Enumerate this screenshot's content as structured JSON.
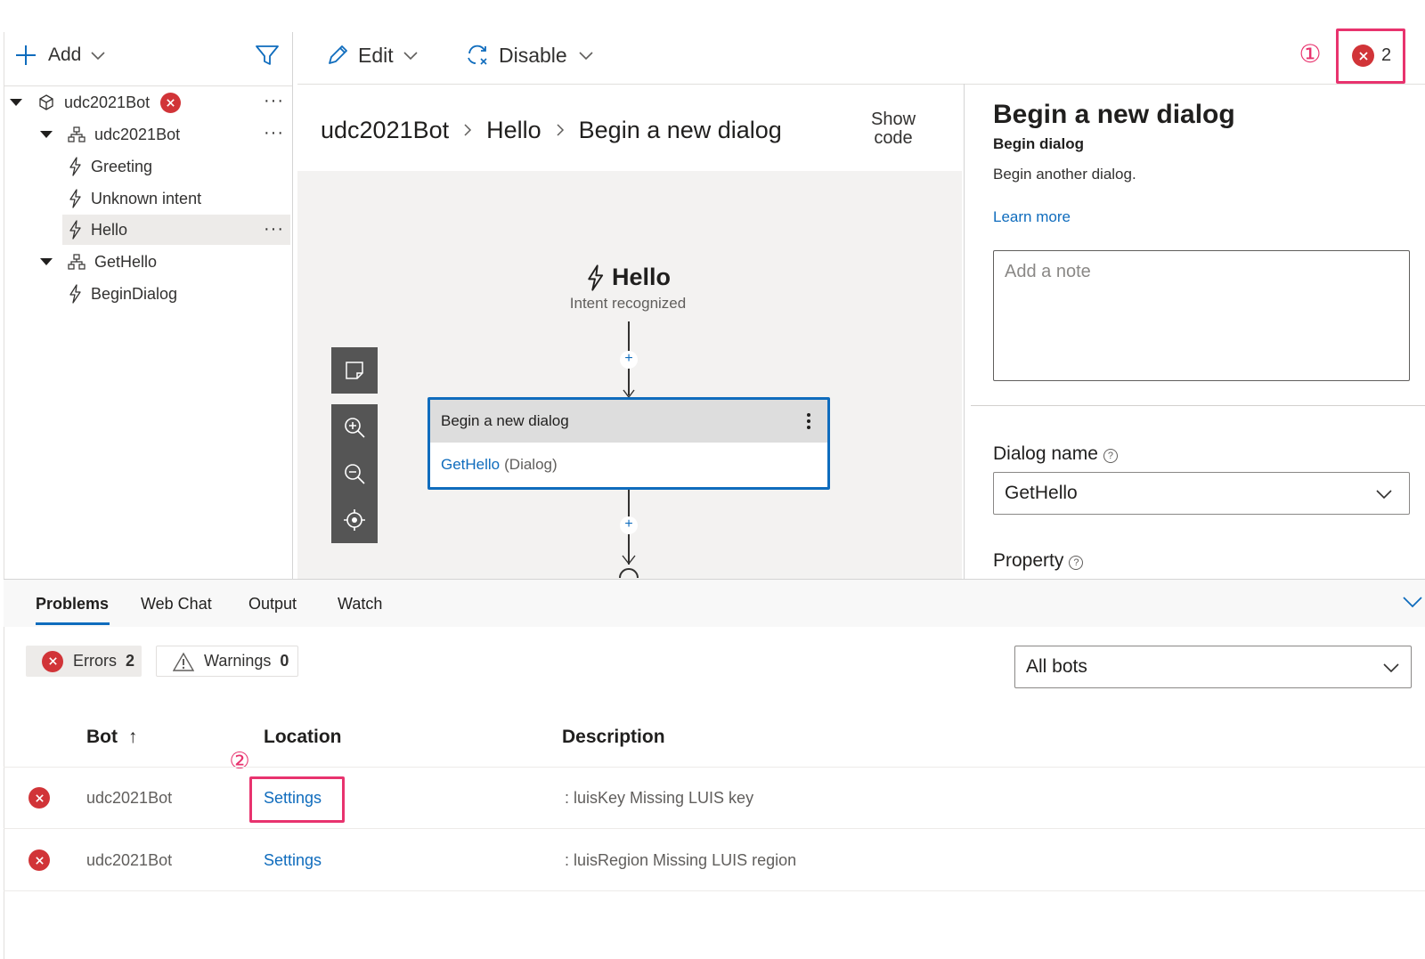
{
  "toolbar": {
    "add_label": "Add",
    "edit_label": "Edit",
    "disable_label": "Disable",
    "error_count": "2",
    "callout_1": "①"
  },
  "tree": {
    "items": [
      {
        "label": "udc2021Bot",
        "type": "bot",
        "has_error": true
      },
      {
        "label": "udc2021Bot",
        "type": "dialog"
      },
      {
        "label": "Greeting",
        "type": "trigger"
      },
      {
        "label": "Unknown intent",
        "type": "trigger"
      },
      {
        "label": "Hello",
        "type": "trigger",
        "selected": true
      },
      {
        "label": "GetHello",
        "type": "dialog"
      },
      {
        "label": "BeginDialog",
        "type": "trigger"
      }
    ]
  },
  "breadcrumb": {
    "items": [
      "udc2021Bot",
      "Hello",
      "Begin a new dialog"
    ],
    "separator": ">"
  },
  "show_code": {
    "line1": "Show",
    "line2": "code"
  },
  "canvas": {
    "trigger_title": "Hello",
    "trigger_subtitle": "Intent recognized",
    "node_title": "Begin a new dialog",
    "node_link": "GetHello",
    "node_suffix": "(Dialog)"
  },
  "properties": {
    "title": "Begin a new dialog",
    "subtitle": "Begin dialog",
    "description": "Begin another dialog.",
    "learn_more": "Learn more",
    "note_placeholder": "Add a note",
    "dialog_name_label": "Dialog name",
    "dialog_name_value": "GetHello",
    "property_label": "Property"
  },
  "bottom": {
    "tabs": [
      "Problems",
      "Web Chat",
      "Output",
      "Watch"
    ],
    "errors_label": "Errors",
    "errors_count": "2",
    "warnings_label": "Warnings",
    "warnings_count": "0",
    "filter_value": "All bots",
    "columns": [
      "Bot",
      "Location",
      "Description"
    ],
    "sort_indicator": "↑",
    "callout_2": "②",
    "rows": [
      {
        "bot": "udc2021Bot",
        "location": "Settings",
        "description": ": luisKey Missing LUIS key"
      },
      {
        "bot": "udc2021Bot",
        "location": "Settings",
        "description": ": luisRegion Missing LUIS region"
      }
    ]
  },
  "colors": {
    "accent": "#0f6cbd",
    "error": "#d13438",
    "annotation": "#e8336e",
    "selected_row": "#edebe9",
    "canvas_bg": "#f3f2f1"
  }
}
